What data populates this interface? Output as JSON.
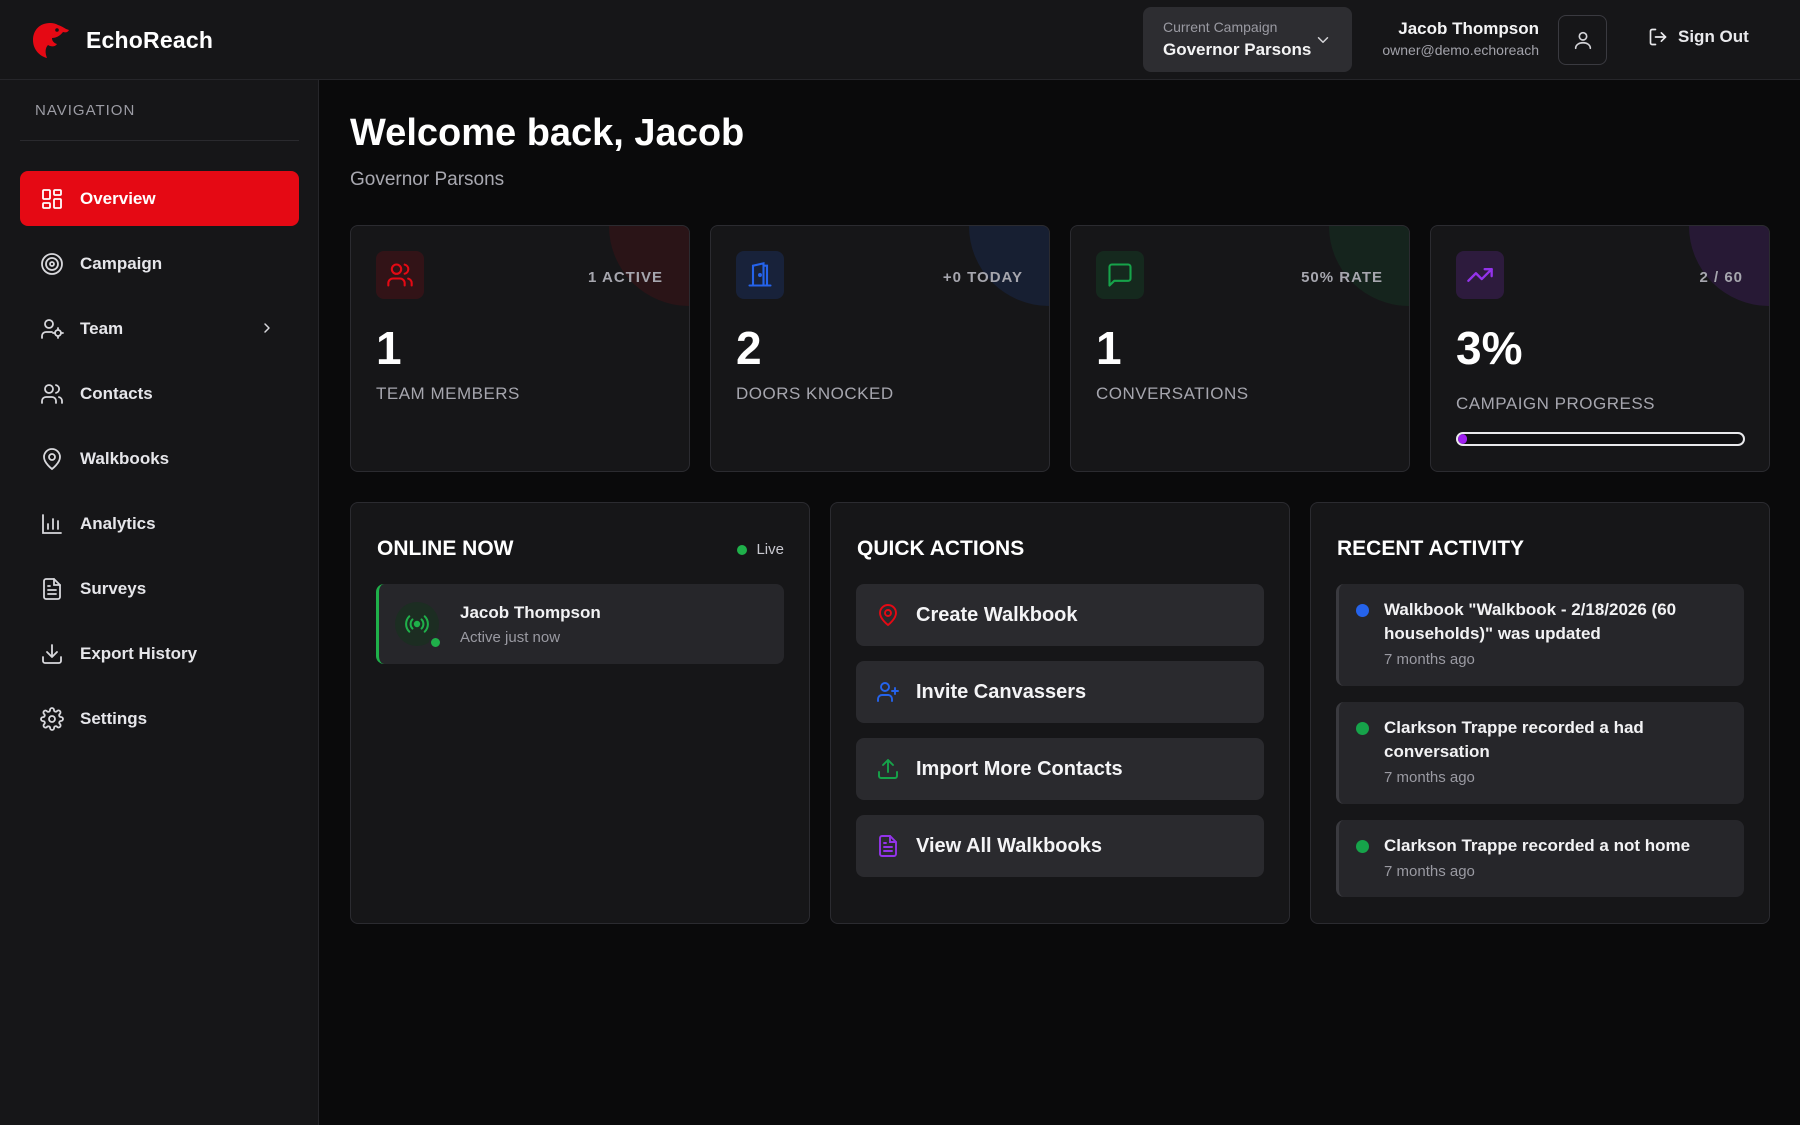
{
  "brand": {
    "name": "EchoReach",
    "accent": "#e50914"
  },
  "header": {
    "campaign_label": "Current Campaign",
    "campaign_value": "Governor Parsons",
    "user_name": "Jacob Thompson",
    "user_email": "owner@demo.echoreach",
    "signout_label": "Sign Out"
  },
  "sidebar": {
    "heading": "NAVIGATION",
    "items": [
      {
        "label": "Overview",
        "icon": "grid-icon",
        "active": true
      },
      {
        "label": "Campaign",
        "icon": "target-icon"
      },
      {
        "label": "Team",
        "icon": "user-cog-icon",
        "has_submenu": true
      },
      {
        "label": "Contacts",
        "icon": "users-icon"
      },
      {
        "label": "Walkbooks",
        "icon": "map-pin-icon"
      },
      {
        "label": "Analytics",
        "icon": "bar-chart-icon"
      },
      {
        "label": "Surveys",
        "icon": "document-icon"
      },
      {
        "label": "Export History",
        "icon": "download-icon"
      },
      {
        "label": "Settings",
        "icon": "gear-icon"
      }
    ]
  },
  "main": {
    "welcome": "Welcome back, Jacob",
    "subtitle": "Governor Parsons",
    "stats": [
      {
        "tag": "1 ACTIVE",
        "value": "1",
        "label": "TEAM MEMBERS",
        "icon": "users-icon",
        "color": "#e50914"
      },
      {
        "tag": "+0 TODAY",
        "value": "2",
        "label": "DOORS KNOCKED",
        "icon": "door-icon",
        "color": "#2563eb"
      },
      {
        "tag": "50% RATE",
        "value": "1",
        "label": "CONVERSATIONS",
        "icon": "message-icon",
        "color": "#16a34a"
      },
      {
        "tag": "2 / 60",
        "value": "3%",
        "label": "CAMPAIGN PROGRESS",
        "icon": "trending-up-icon",
        "color": "#9333ea",
        "progress": 0.03
      }
    ],
    "online": {
      "title": "ONLINE NOW",
      "live_label": "Live",
      "users": [
        {
          "name": "Jacob Thompson",
          "status": "Active just now"
        }
      ]
    },
    "quick_actions": {
      "title": "QUICK ACTIONS",
      "items": [
        {
          "label": "Create Walkbook",
          "icon": "map-pin-icon",
          "color": "#e50914"
        },
        {
          "label": "Invite Canvassers",
          "icon": "user-plus-icon",
          "color": "#2563eb"
        },
        {
          "label": "Import More Contacts",
          "icon": "upload-icon",
          "color": "#16a34a"
        },
        {
          "label": "View All Walkbooks",
          "icon": "document-icon",
          "color": "#9333ea"
        }
      ]
    },
    "recent_activity": {
      "title": "RECENT ACTIVITY",
      "items": [
        {
          "text": "Walkbook \"Walkbook - 2/18/2026 (60 households)\" was updated",
          "time": "7 months ago",
          "dot_color": "#2563eb"
        },
        {
          "text": "Clarkson Trappe recorded a had conversation",
          "time": "7 months ago",
          "dot_color": "#16a34a"
        },
        {
          "text": "Clarkson Trappe recorded a not home",
          "time": "7 months ago",
          "dot_color": "#16a34a"
        }
      ]
    }
  }
}
